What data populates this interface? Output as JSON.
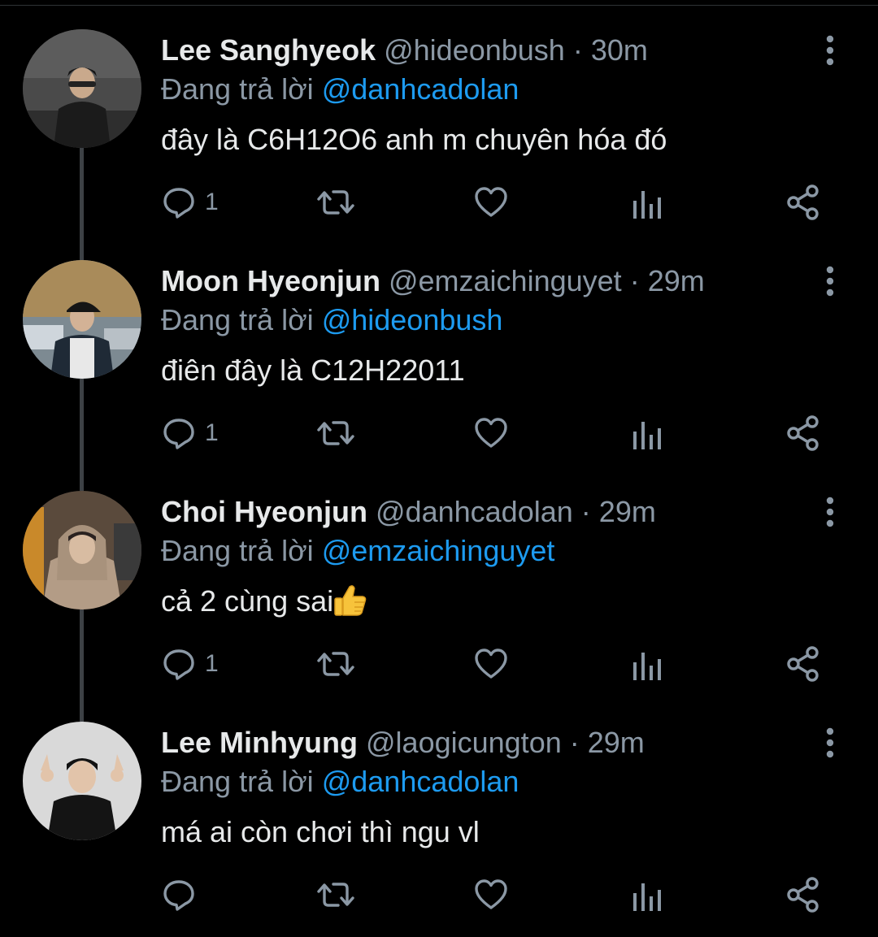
{
  "colors": {
    "background": "#000000",
    "text": "#e7e9ea",
    "secondary": "#8b98a5",
    "mention": "#1d9bf0",
    "thread_line": "#3d4145"
  },
  "separator": "·",
  "tweets": [
    {
      "name": "Lee Sanghyeok",
      "handle": "@hideonbush",
      "time": "30m",
      "reply_prefix": "Đang trả lời",
      "reply_to": "@danhcadolan",
      "text": "đây là C6H12O6 anh m chuyên hóa đó",
      "reply_count": "1"
    },
    {
      "name": "Moon Hyeonjun",
      "handle": "@emzaichinguyet",
      "time": "29m",
      "reply_prefix": "Đang trả lời",
      "reply_to": "@hideonbush",
      "text": "điên đây là C12H22011",
      "reply_count": "1"
    },
    {
      "name": "Choi Hyeonjun",
      "handle": "@danhcadolan",
      "time": "29m",
      "reply_prefix": "Đang trả lời",
      "reply_to": "@emzaichinguyet",
      "text": "cả 2 cùng sai",
      "emoji": "thumbs-up",
      "reply_count": "1"
    },
    {
      "name": "Lee Minhyung",
      "handle": "@laogicungton",
      "time": "29m",
      "reply_prefix": "Đang trả lời",
      "reply_to": "@danhcadolan",
      "text": "má ai còn chơi thì ngu vl",
      "reply_count": ""
    }
  ],
  "icons": {
    "reply": "reply-icon",
    "retweet": "retweet-icon",
    "like": "like-icon",
    "analytics": "analytics-icon",
    "share": "share-icon",
    "more": "more-options-icon"
  }
}
